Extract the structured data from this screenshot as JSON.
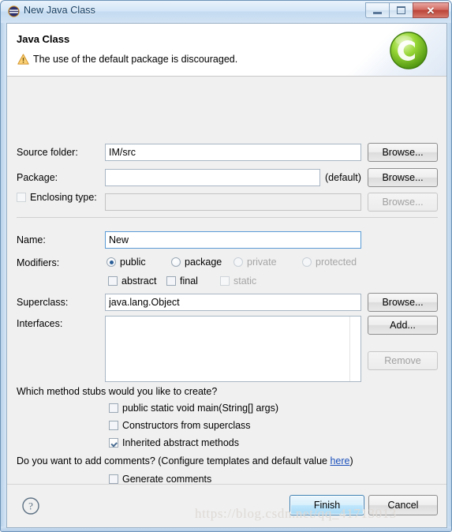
{
  "window": {
    "title": "New Java Class",
    "icon": "java-class-icon",
    "controls": {
      "minimize": "minimize-button",
      "maximize": "maximize-button",
      "close_glyph": "✕"
    }
  },
  "header": {
    "title": "Java Class",
    "message": "The use of the default package is discouraged.",
    "warning_icon": "warning-triangle-icon",
    "banner_icon": "green-c-class-icon"
  },
  "form": {
    "source_folder": {
      "label": "Source folder:",
      "value": "IM/src",
      "placeholder": "",
      "browse_label": "Browse..."
    },
    "package": {
      "label": "Package:",
      "value": "",
      "placeholder": "",
      "suffix": "(default)",
      "browse_label": "Browse..."
    },
    "enclosing_type": {
      "label": "Enclosing type:",
      "checked": false,
      "value": "",
      "placeholder": "",
      "browse_label": "Browse...",
      "disabled": true
    },
    "name": {
      "label": "Name:",
      "value": "New",
      "placeholder": ""
    },
    "modifiers": {
      "label": "Modifiers:",
      "radios": [
        {
          "label": "public",
          "selected": true,
          "disabled": false
        },
        {
          "label": "package",
          "selected": false,
          "disabled": false
        },
        {
          "label": "private",
          "selected": false,
          "disabled": true
        },
        {
          "label": "protected",
          "selected": false,
          "disabled": true
        }
      ],
      "checkboxes": [
        {
          "label": "abstract",
          "checked": false,
          "disabled": false
        },
        {
          "label": "final",
          "checked": false,
          "disabled": false
        },
        {
          "label": "static",
          "checked": false,
          "disabled": true
        }
      ]
    },
    "superclass": {
      "label": "Superclass:",
      "value": "java.lang.Object",
      "placeholder": "",
      "browse_label": "Browse..."
    },
    "interfaces": {
      "label": "Interfaces:",
      "items": [],
      "add_label": "Add...",
      "remove_label": "Remove",
      "remove_disabled": true
    }
  },
  "stubs": {
    "question": "Which method stubs would you like to create?",
    "options": [
      {
        "label": "public static void main(String[] args)",
        "checked": false
      },
      {
        "label": "Constructors from superclass",
        "checked": false
      },
      {
        "label": "Inherited abstract methods",
        "checked": true
      }
    ]
  },
  "comments": {
    "question_prefix": "Do you want to add comments? (Configure templates and default value ",
    "link": "here",
    "question_suffix": ")",
    "option": {
      "label": "Generate comments",
      "checked": false
    }
  },
  "footer": {
    "help_icon": "help-question-icon",
    "finish_label": "Finish",
    "cancel_label": "Cancel"
  },
  "watermark": "https://blog.csdn.net/qq_41713013"
}
